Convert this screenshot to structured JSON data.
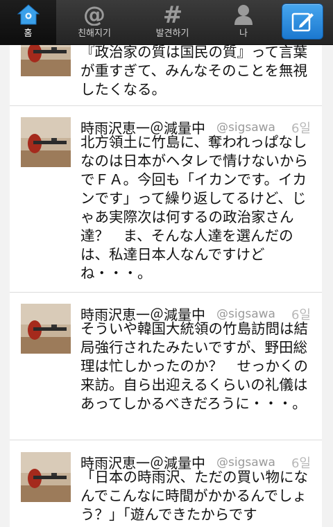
{
  "nav": {
    "tabs": [
      {
        "label": "홈",
        "icon": "home-icon",
        "active": true
      },
      {
        "label": "친해지기",
        "icon": "at-icon",
        "active": false
      },
      {
        "label": "발견하기",
        "icon": "hash-icon",
        "active": false
      },
      {
        "label": "나",
        "icon": "person-icon",
        "active": false
      }
    ],
    "compose_icon": "compose-icon",
    "accent": "#2b8ce0"
  },
  "tweets": [
    {
      "text": "『政治家の質は国民の質』って言葉が重すぎて、みんなそのことを無視したくなる。"
    },
    {
      "author": "時雨沢恵一＠減量中",
      "handle": "@sigsawa",
      "time": "6일",
      "text": "北方領土に竹島に、奪われっぱなしなのは日本がヘタレで情けないからでＦＡ。今回も「イカンです。イカンです」って繰り返してるけど、じゃあ実際次は何するの政治家さん達？　ま、そんな人達を選んだのは、私達日本人なんですけどね・・・。"
    },
    {
      "author": "時雨沢恵一＠減量中",
      "handle": "@sigsawa",
      "time": "6일",
      "text": "そういや韓国大統領の竹島訪問は結局強行されたみたいですが、野田総理は忙しかったのか？　せっかくの来訪。自ら出迎えるくらいの礼儀はあってしかるべきだろうに・・・。"
    },
    {
      "author": "時雨沢恵一＠減量中",
      "handle": "@sigsawa",
      "time": "6일",
      "text": "「日本の時雨沢、ただの買い物になんでこんなに時間がかかるんでしょう？」「遊んできたからです"
    }
  ]
}
